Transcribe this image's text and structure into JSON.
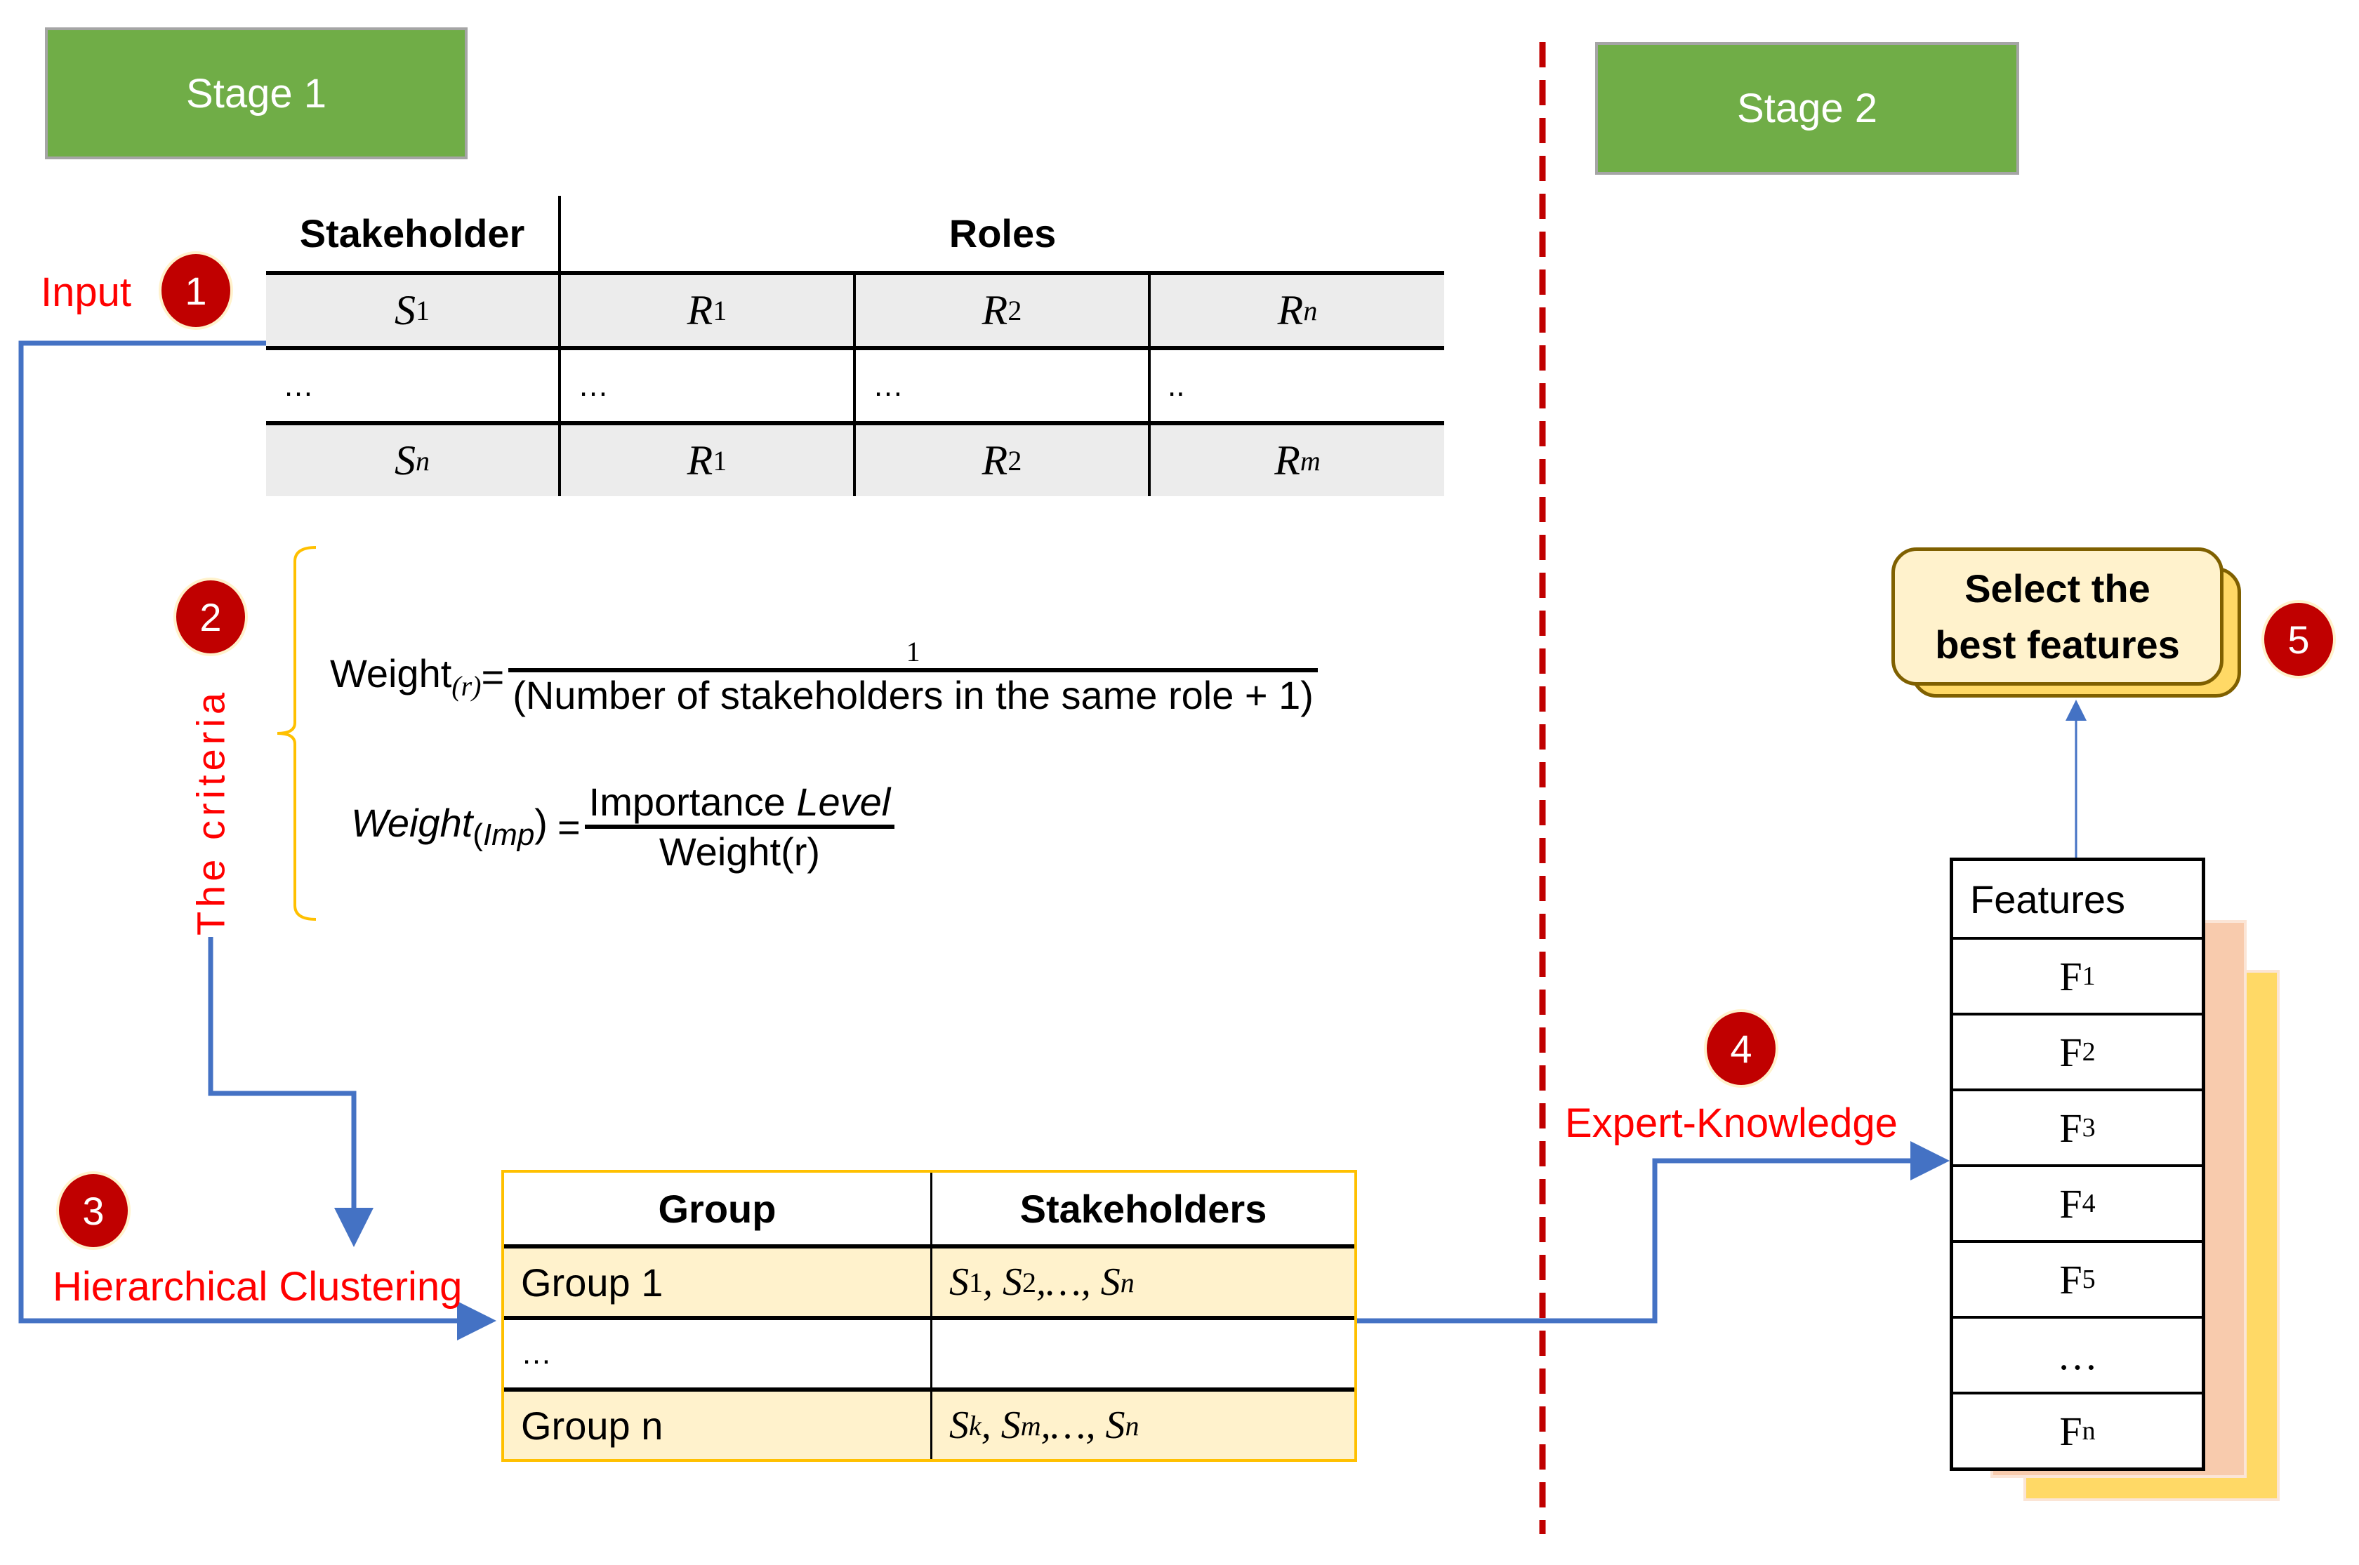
{
  "stages": {
    "stage1": "Stage 1",
    "stage2": "Stage 2"
  },
  "steps": {
    "step1": {
      "number": "1",
      "label": "Input"
    },
    "step2": {
      "number": "2",
      "label": "The criteria"
    },
    "step3": {
      "number": "3",
      "label": "Hierarchical Clustering"
    },
    "step4": {
      "number": "4",
      "label": "Expert-Knowledge"
    },
    "step5": {
      "number": "5",
      "label": "Select the best features"
    }
  },
  "roles_table": {
    "headers": {
      "stakeholder": "Stakeholder",
      "roles": "Roles"
    },
    "rows": [
      {
        "s": "S",
        "s_sub": "1",
        "r": [
          {
            "b": "R",
            "sub": "1"
          },
          {
            "b": "R",
            "sub": "2"
          },
          {
            "b": "R",
            "sub": "n"
          }
        ]
      },
      {
        "s": "…",
        "r": [
          {
            "b": "…"
          },
          {
            "b": "…"
          },
          {
            "b": ".."
          }
        ]
      },
      {
        "s": "S",
        "s_sub": "n",
        "r": [
          {
            "b": "R",
            "sub": "1"
          },
          {
            "b": "R",
            "sub": "2"
          },
          {
            "b": "R",
            "sub": "m"
          }
        ]
      }
    ]
  },
  "formulas": {
    "weight_r": {
      "lhs": "Weight",
      "lhs_sub": "(r)",
      "eq": "=",
      "numerator": "1",
      "denominator": "(Number of stakeholders in the same role + 1)"
    },
    "weight_imp": {
      "lhs": "Weight",
      "lhs_sub_open": "(",
      "lhs_sub": "Imp",
      "lhs_sub_close": ")",
      "eq": "=",
      "numerator": "Importance",
      "numerator_italic": "Level",
      "denominator": "Weight(r)"
    }
  },
  "group_table": {
    "headers": {
      "group": "Group",
      "stakeholders": "Stakeholders"
    },
    "rows": [
      {
        "group": "Group 1",
        "stakeholders": [
          {
            "b": "S",
            "sub": "1"
          },
          {
            "b": "S",
            "sub": "2"
          },
          {
            "b": "…"
          },
          {
            "b": "S",
            "sub": "n"
          }
        ]
      },
      {
        "group": "…",
        "stakeholders": []
      },
      {
        "group": "Group n",
        "stakeholders": [
          {
            "b": "S",
            "sub": "k"
          },
          {
            "b": "S",
            "sub": "m"
          },
          {
            "b": "…"
          },
          {
            "b": "S",
            "sub": "n"
          }
        ]
      }
    ]
  },
  "features_table": {
    "header": "Features",
    "rows": [
      {
        "b": "F",
        "sub": "1"
      },
      {
        "b": "F",
        "sub": "2"
      },
      {
        "b": "F",
        "sub": "3"
      },
      {
        "b": "F",
        "sub": "4"
      },
      {
        "b": "F",
        "sub": "5"
      },
      {
        "b": "…",
        "sub": ""
      },
      {
        "b": "F",
        "sub": "n"
      }
    ]
  },
  "select_box": {
    "line1": "Select the",
    "line2": "best features"
  },
  "colors": {
    "stage_green": "#70ad47",
    "badge_red": "#c00000",
    "label_red": "#ff0000",
    "arrow_blue": "#4472c4",
    "divider_red": "#c00000",
    "group_fill": "#fff2cc",
    "group_border": "#ffc000"
  }
}
